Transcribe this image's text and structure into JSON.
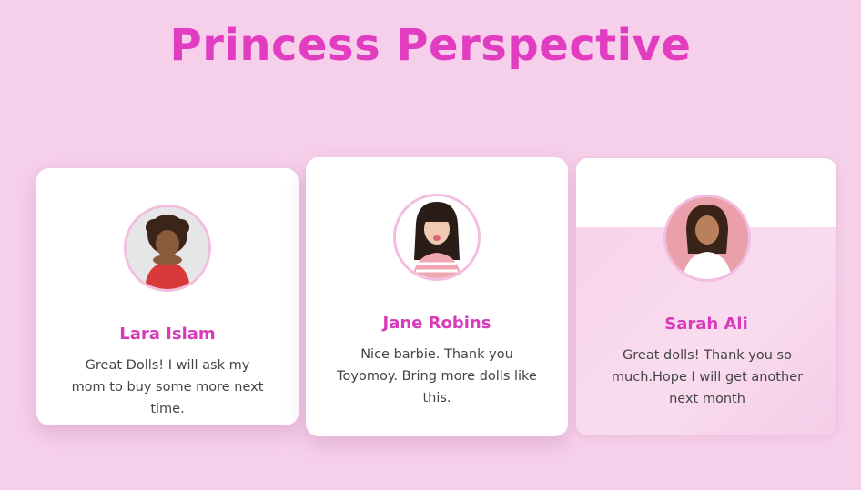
{
  "page": {
    "title": "Princess Perspective"
  },
  "colors": {
    "background": "#f6d0ea",
    "accent": "#e23cc0",
    "card": "#ffffff"
  },
  "testimonials": [
    {
      "name": "Lara Islam",
      "quote": "Great Dolls! I will ask my mom to buy some more next time.",
      "avatar_icon": "girl-photo-avatar"
    },
    {
      "name": "Jane Robins",
      "quote": "Nice barbie. Thank you Toyomoy. Bring more dolls like this.",
      "avatar_icon": "girl-photo-avatar"
    },
    {
      "name": "Sarah Ali",
      "quote": "Great dolls! Thank you so much.Hope I will get another next month",
      "avatar_icon": "girl-photo-avatar"
    }
  ]
}
